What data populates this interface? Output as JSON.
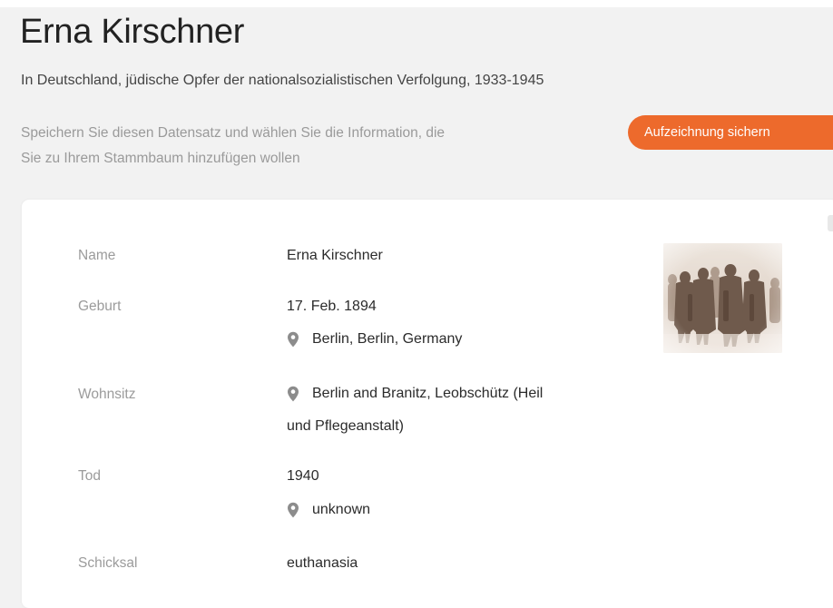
{
  "record": {
    "title": "Erna Kirschner",
    "collection": "In Deutschland, jüdische Opfer der nationalsozialistischen Verfolgung, 1933-1945",
    "save_hint_line1": "Speichern Sie diesen Datensatz und wählen Sie die Information, die",
    "save_hint_line2": "Sie zu Ihrem Stammbaum hinzufügen wollen",
    "save_button_label": "Aufzeichnung sichern"
  },
  "fields": {
    "name": {
      "label": "Name",
      "value": "Erna Kirschner"
    },
    "birth": {
      "label": "Geburt",
      "date": "17. Feb. 1894",
      "place": "Berlin, Berlin, Germany"
    },
    "residence": {
      "label": "Wohnsitz",
      "place_line1": "Berlin and Branitz, Leobschütz (Heil",
      "place_line2": "und Pflegeanstalt)"
    },
    "death": {
      "label": "Tod",
      "date": "1940",
      "place": "unknown"
    },
    "fate": {
      "label": "Schicksal",
      "value": "euthanasia"
    }
  },
  "icons": {
    "location": "location-pin-icon"
  },
  "colors": {
    "accent": "#ed6a2c",
    "background": "#f2f2f2",
    "card": "#ffffff",
    "label": "#9b9b9b",
    "text": "#2b2b2b",
    "pin": "#8c8c8c"
  }
}
